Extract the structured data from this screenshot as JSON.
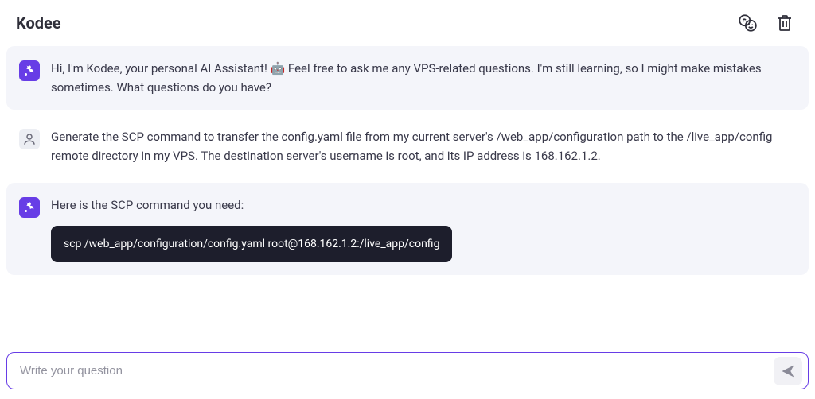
{
  "header": {
    "title": "Kodee"
  },
  "messages": {
    "bot_intro": "Hi, I'm Kodee, your personal AI Assistant! 🤖 Feel free to ask me any VPS-related questions. I'm still learning, so I might make mistakes sometimes. What questions do you have?",
    "user_request": "Generate the SCP command to transfer the config.yaml file from my current server's /web_app/configuration path to the /live_app/config remote directory in my VPS. The destination server's username is root, and its IP address is 168.162.1.2.",
    "bot_reply_intro": "Here is the SCP command you need:",
    "bot_reply_code": "scp /web_app/configuration/config.yaml root@168.162.1.2:/live_app/config"
  },
  "input": {
    "placeholder": "Write your question",
    "value": ""
  }
}
